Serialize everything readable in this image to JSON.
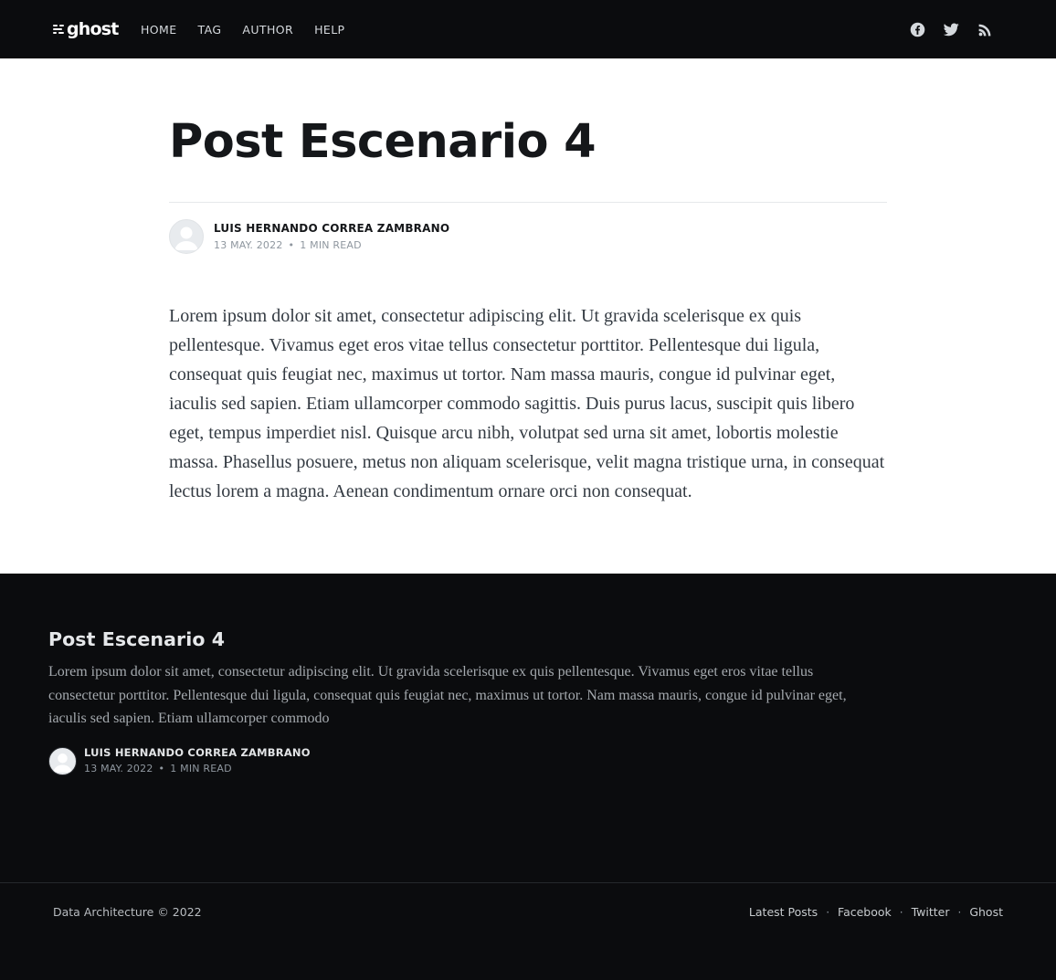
{
  "header": {
    "logo_text": "ghost",
    "nav": [
      "HOME",
      "TAG",
      "AUTHOR",
      "HELP"
    ],
    "social_icons": [
      "facebook-icon",
      "twitter-icon",
      "rss-icon"
    ]
  },
  "article": {
    "title": "Post Escenario 4",
    "author": "LUIS HERNANDO CORREA ZAMBRANO",
    "date": "13 MAY. 2022",
    "meta_separator": "•",
    "read_time": "1 MIN READ",
    "body": "Lorem ipsum dolor sit amet, consectetur adipiscing elit. Ut gravida scelerisque ex quis pellentesque. Vivamus eget eros vitae tellus consectetur porttitor. Pellentesque dui ligula, consequat quis feugiat nec, maximus ut tortor. Nam massa mauris, congue id pulvinar eget, iaculis sed sapien. Etiam ullamcorper commodo sagittis. Duis purus lacus, suscipit quis libero eget, tempus imperdiet nisl. Quisque arcu nibh, volutpat sed urna sit amet, lobortis molestie massa. Phasellus posuere, metus non aliquam scelerisque, velit magna tristique urna, in consequat lectus lorem a magna. Aenean condimentum ornare orci non consequat."
  },
  "related": {
    "title": "Post Escenario 4",
    "excerpt": "Lorem ipsum dolor sit amet, consectetur adipiscing elit. Ut gravida scelerisque ex quis pellentesque. Vivamus eget eros vitae tellus consectetur porttitor. Pellentesque dui ligula, consequat quis feugiat nec, maximus ut tortor. Nam massa mauris, congue id pulvinar eget, iaculis sed sapien. Etiam ullamcorper commodo",
    "author": "LUIS HERNANDO CORREA ZAMBRANO",
    "date": "13 MAY. 2022",
    "meta_separator": "•",
    "read_time": "1 MIN READ"
  },
  "footer": {
    "copyright": "Data Architecture © 2022",
    "link_separator": "·",
    "links": [
      "Latest Posts",
      "Facebook",
      "Twitter",
      "Ghost"
    ]
  }
}
